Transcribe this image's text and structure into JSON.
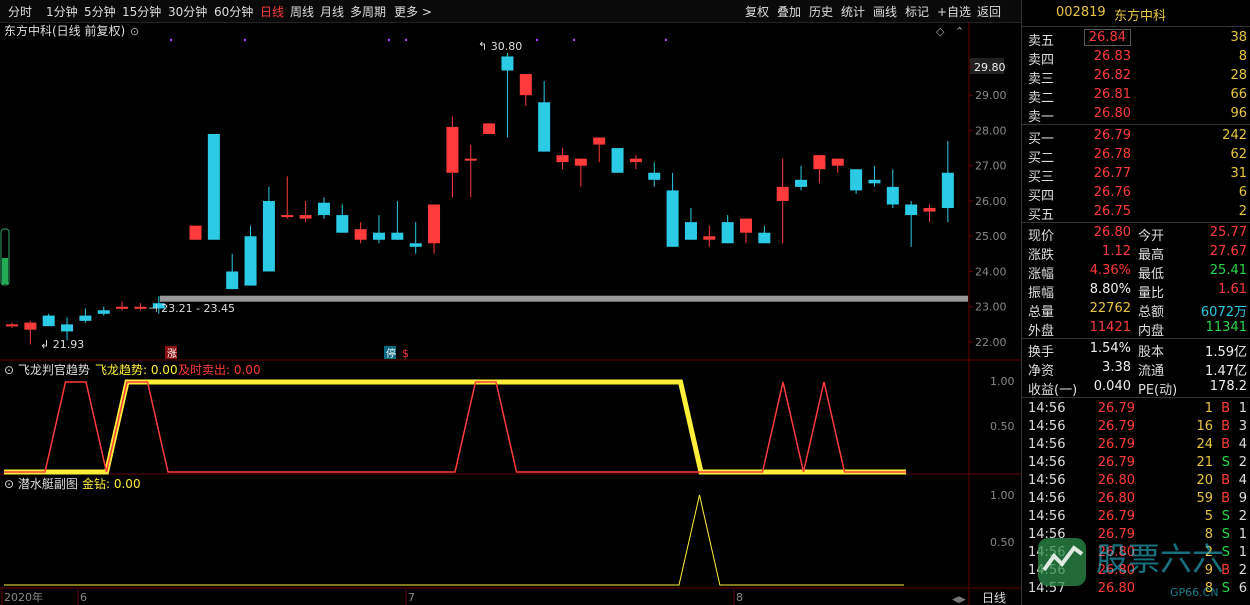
{
  "toolbar": {
    "periods": [
      "分时",
      "1分钟",
      "5分钟",
      "15分钟",
      "30分钟",
      "60分钟",
      "日线",
      "周线",
      "月线",
      "多周期",
      "更多"
    ],
    "active_period": "日线",
    "right_tools": [
      "复权",
      "叠加",
      "历史",
      "统计",
      "画线",
      "标记",
      "+自选",
      "返回"
    ]
  },
  "chart_title": "东方中科(日线 前复权)",
  "price_axis": [
    "29.80",
    "29.00",
    "28.00",
    "27.00",
    "26.00",
    "25.00",
    "24.00",
    "23.00",
    "22.00"
  ],
  "annotations": {
    "high": "30.80",
    "low": "21.93",
    "range": "23.21 - 23.45",
    "zhang": "涨",
    "ting": "停",
    "dollar": "$"
  },
  "indicator1": {
    "name": "飞龙判官趋势",
    "line1": "飞龙趋势: 0.00",
    "line2": "及时卖出: 0.00",
    "axis": [
      "1.00",
      "0.50"
    ]
  },
  "indicator2": {
    "name": "潜水艇副图",
    "line1": "金钻: 0.00",
    "axis": [
      "1.00",
      "0.50"
    ]
  },
  "time_axis": {
    "labels": [
      "2020年",
      "6",
      "7",
      "8"
    ],
    "period": "日线"
  },
  "chart_data": {
    "type": "candlestick",
    "candles": [
      [
        22.5,
        22.55,
        22.4,
        22.5
      ],
      [
        22.35,
        22.6,
        21.93,
        22.55
      ],
      [
        22.75,
        22.8,
        22.45,
        22.45
      ],
      [
        22.5,
        22.7,
        22.05,
        22.3
      ],
      [
        22.75,
        22.95,
        22.55,
        22.6
      ],
      [
        22.9,
        23.0,
        22.75,
        22.8
      ],
      [
        22.95,
        23.15,
        22.9,
        23.0
      ],
      [
        22.95,
        23.1,
        22.9,
        23.0
      ],
      [
        23.1,
        23.3,
        22.8,
        22.95
      ],
      [
        null,
        null,
        null,
        null
      ],
      [
        24.9,
        25.3,
        24.9,
        25.3
      ],
      [
        27.9,
        27.9,
        24.9,
        24.9
      ],
      [
        24.0,
        24.5,
        23.6,
        23.5
      ],
      [
        25.0,
        25.3,
        23.6,
        23.6
      ],
      [
        26.0,
        26.4,
        24.0,
        24.0
      ],
      [
        25.6,
        26.7,
        25.5,
        25.6
      ],
      [
        25.5,
        26.0,
        25.4,
        25.6
      ],
      [
        25.95,
        26.1,
        25.5,
        25.6
      ],
      [
        25.6,
        25.9,
        25.1,
        25.1
      ],
      [
        24.9,
        25.4,
        24.8,
        25.2
      ],
      [
        25.1,
        25.6,
        24.8,
        24.9
      ],
      [
        25.1,
        26.0,
        24.9,
        24.9
      ],
      [
        24.8,
        25.4,
        24.5,
        24.7
      ],
      [
        24.8,
        25.5,
        24.5,
        25.9
      ],
      [
        26.8,
        28.4,
        26.1,
        28.1
      ],
      [
        27.2,
        27.6,
        26.1,
        27.2
      ],
      [
        27.9,
        27.8,
        28.5,
        28.2
      ],
      [
        30.1,
        30.2,
        27.8,
        29.7
      ],
      [
        29.0,
        29.6,
        28.7,
        29.6
      ],
      [
        28.8,
        29.4,
        27.4,
        27.4
      ],
      [
        27.1,
        27.5,
        26.9,
        27.3
      ],
      [
        27.0,
        27.2,
        26.4,
        27.2
      ],
      [
        27.6,
        27.8,
        27.1,
        27.8
      ],
      [
        27.5,
        27.5,
        26.8,
        26.8
      ],
      [
        27.1,
        27.3,
        26.9,
        27.2
      ],
      [
        26.8,
        27.1,
        26.4,
        26.6
      ],
      [
        26.3,
        26.8,
        24.7,
        24.7
      ],
      [
        25.4,
        25.8,
        24.9,
        24.9
      ],
      [
        24.9,
        25.3,
        24.7,
        25.0
      ],
      [
        25.4,
        25.6,
        24.8,
        24.8
      ],
      [
        25.1,
        25.4,
        24.8,
        25.5
      ],
      [
        25.1,
        25.3,
        24.8,
        24.8
      ],
      [
        26.0,
        27.2,
        24.8,
        26.4
      ],
      [
        26.6,
        27.0,
        26.3,
        26.4
      ],
      [
        26.9,
        27.3,
        26.5,
        27.3
      ],
      [
        27.0,
        27.2,
        26.8,
        27.2
      ],
      [
        26.9,
        26.8,
        26.2,
        26.3
      ],
      [
        26.6,
        27.0,
        26.4,
        26.5
      ],
      [
        26.4,
        26.9,
        25.8,
        25.9
      ],
      [
        25.9,
        26.0,
        24.7,
        25.6
      ],
      [
        25.7,
        25.9,
        25.4,
        25.8
      ],
      [
        26.8,
        27.7,
        25.4,
        25.8
      ]
    ],
    "indicator1_red": [
      0,
      0,
      0,
      1,
      1,
      0,
      1,
      1,
      0,
      0,
      0,
      0,
      0,
      0,
      0,
      0,
      0,
      0,
      0,
      0,
      0,
      0,
      0,
      1,
      1,
      0,
      0,
      0,
      0,
      0,
      0,
      0,
      0,
      0,
      0,
      0,
      0,
      0,
      1,
      0,
      1,
      0,
      0,
      0,
      0
    ],
    "indicator1_yellow": [
      0,
      0,
      0,
      0,
      0,
      0,
      1,
      1,
      1,
      1,
      1,
      1,
      1,
      1,
      1,
      1,
      1,
      1,
      1,
      1,
      1,
      1,
      1,
      1,
      1,
      1,
      1,
      1,
      1,
      1,
      1,
      1,
      1,
      1,
      0,
      0,
      0,
      0,
      0,
      0,
      0,
      0,
      0,
      0,
      0
    ],
    "indicator2": [
      0,
      0,
      0,
      0,
      0,
      0,
      0,
      0,
      0,
      0,
      0,
      0,
      0,
      0,
      0,
      0,
      0,
      0,
      0,
      0,
      0,
      0,
      0,
      0,
      0,
      0,
      0,
      0,
      0,
      0,
      0,
      0,
      0,
      0,
      1,
      0,
      0,
      0,
      0,
      0,
      0,
      0,
      0,
      0,
      0
    ]
  },
  "quote": {
    "code": "002819",
    "name": "东方中科",
    "asks": [
      {
        "label": "卖五",
        "price": "26.84",
        "vol": "38"
      },
      {
        "label": "卖四",
        "price": "26.83",
        "vol": "8"
      },
      {
        "label": "卖三",
        "price": "26.82",
        "vol": "28"
      },
      {
        "label": "卖二",
        "price": "26.81",
        "vol": "66"
      },
      {
        "label": "卖一",
        "price": "26.80",
        "vol": "96"
      }
    ],
    "bids": [
      {
        "label": "买一",
        "price": "26.79",
        "vol": "242"
      },
      {
        "label": "买二",
        "price": "26.78",
        "vol": "62"
      },
      {
        "label": "买三",
        "price": "26.77",
        "vol": "31"
      },
      {
        "label": "买四",
        "price": "26.76",
        "vol": "6"
      },
      {
        "label": "买五",
        "price": "26.75",
        "vol": "2"
      }
    ],
    "stats": [
      {
        "l1": "现价",
        "v1": "26.80",
        "c1": "red",
        "l2": "今开",
        "v2": "25.77",
        "c2": "red"
      },
      {
        "l1": "涨跌",
        "v1": "1.12",
        "c1": "red",
        "l2": "最高",
        "v2": "27.67",
        "c2": "red"
      },
      {
        "l1": "涨幅",
        "v1": "4.36%",
        "c1": "red",
        "l2": "最低",
        "v2": "25.41",
        "c2": "green"
      },
      {
        "l1": "振幅",
        "v1": "8.80%",
        "c1": "white",
        "l2": "量比",
        "v2": "1.61",
        "c2": "red"
      },
      {
        "l1": "总量",
        "v1": "22762",
        "c1": "yellow",
        "l2": "总额",
        "v2": "6072万",
        "c2": "cyan"
      },
      {
        "l1": "外盘",
        "v1": "11421",
        "c1": "red",
        "l2": "内盘",
        "v2": "11341",
        "c2": "green"
      }
    ],
    "stats2": [
      {
        "l1": "换手",
        "v1": "1.54%",
        "l2": "股本",
        "v2": "1.59亿"
      },
      {
        "l1": "净资",
        "v1": "3.38",
        "l2": "流通",
        "v2": "1.47亿"
      },
      {
        "l1": "收益(一)",
        "v1": "0.040",
        "l2": "PE(动)",
        "v2": "178.2"
      }
    ],
    "trades": [
      {
        "t": "14:56",
        "p": "26.79",
        "v": "1",
        "bs": "B",
        "n": "1"
      },
      {
        "t": "14:56",
        "p": "26.79",
        "v": "16",
        "bs": "B",
        "n": "3"
      },
      {
        "t": "14:56",
        "p": "26.79",
        "v": "24",
        "bs": "B",
        "n": "4"
      },
      {
        "t": "14:56",
        "p": "26.79",
        "v": "21",
        "bs": "S",
        "n": "2"
      },
      {
        "t": "14:56",
        "p": "26.80",
        "v": "20",
        "bs": "B",
        "n": "4"
      },
      {
        "t": "14:56",
        "p": "26.80",
        "v": "59",
        "bs": "B",
        "n": "9"
      },
      {
        "t": "14:56",
        "p": "26.79",
        "v": "5",
        "bs": "S",
        "n": "2"
      },
      {
        "t": "14:56",
        "p": "26.79",
        "v": "8",
        "bs": "S",
        "n": "1"
      },
      {
        "t": "14:56",
        "p": "26.80",
        "v": "2",
        "bs": "S",
        "n": "1"
      },
      {
        "t": "14:56",
        "p": "26.80",
        "v": "9",
        "bs": "B",
        "n": "2"
      },
      {
        "t": "14:57",
        "p": "26.80",
        "v": "8",
        "bs": "S",
        "n": "6"
      }
    ]
  },
  "watermark": {
    "text": "股票六六",
    "sub": "GP66.CN"
  },
  "colors": {
    "up": "#ff3b3b",
    "down": "#2ccbe5",
    "yellow": "#ffef3a",
    "grid": "#3a0a0a"
  }
}
